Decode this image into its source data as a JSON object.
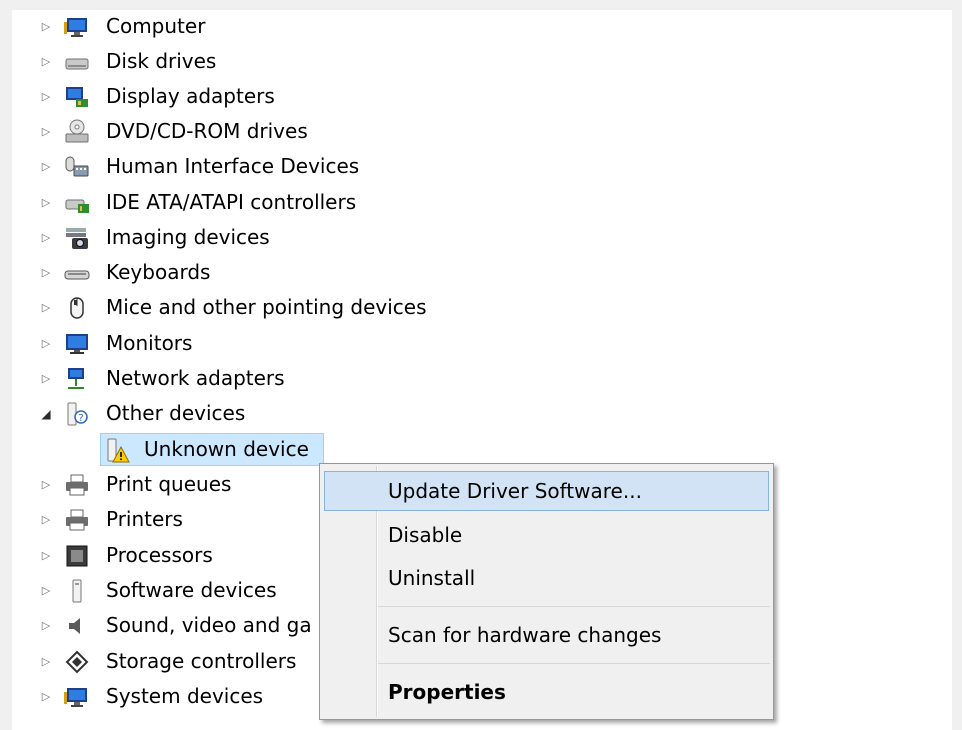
{
  "tree": {
    "items": [
      {
        "label": "Computer",
        "icon": "computer-icon",
        "expanded": false
      },
      {
        "label": "Disk drives",
        "icon": "disk-drive-icon",
        "expanded": false
      },
      {
        "label": "Display adapters",
        "icon": "display-adapter-icon",
        "expanded": false
      },
      {
        "label": "DVD/CD-ROM drives",
        "icon": "dvd-drive-icon",
        "expanded": false
      },
      {
        "label": "Human Interface Devices",
        "icon": "hid-icon",
        "expanded": false
      },
      {
        "label": "IDE ATA/ATAPI controllers",
        "icon": "ide-controller-icon",
        "expanded": false
      },
      {
        "label": "Imaging devices",
        "icon": "camera-icon",
        "expanded": false
      },
      {
        "label": "Keyboards",
        "icon": "keyboard-icon",
        "expanded": false
      },
      {
        "label": "Mice and other pointing devices",
        "icon": "mouse-icon",
        "expanded": false
      },
      {
        "label": "Monitors",
        "icon": "monitor-icon",
        "expanded": false
      },
      {
        "label": "Network adapters",
        "icon": "network-icon",
        "expanded": false
      },
      {
        "label": "Other devices",
        "icon": "unknown-device-icon",
        "expanded": true
      },
      {
        "label": "Unknown device",
        "icon": "warning-device-icon",
        "child": true,
        "selected": true
      },
      {
        "label": "Print queues",
        "icon": "printer-icon",
        "expanded": false
      },
      {
        "label": "Printers",
        "icon": "printer-icon",
        "expanded": false
      },
      {
        "label": "Processors",
        "icon": "processor-icon",
        "expanded": false
      },
      {
        "label": "Software devices",
        "icon": "software-device-icon",
        "expanded": false
      },
      {
        "label": "Sound, video and ga",
        "icon": "speaker-icon",
        "expanded": false
      },
      {
        "label": "Storage controllers",
        "icon": "storage-controller-icon",
        "expanded": false
      },
      {
        "label": "System devices",
        "icon": "system-device-icon",
        "expanded": false
      }
    ]
  },
  "context_menu": {
    "update_driver": "Update Driver Software...",
    "disable": "Disable",
    "uninstall": "Uninstall",
    "scan": "Scan for hardware changes",
    "properties": "Properties"
  },
  "colors": {
    "selection_bg": "#cce8ff",
    "selection_border": "#99d1ff",
    "menu_hover_bg": "#d1e3f5",
    "menu_hover_border": "#86b4e2"
  }
}
